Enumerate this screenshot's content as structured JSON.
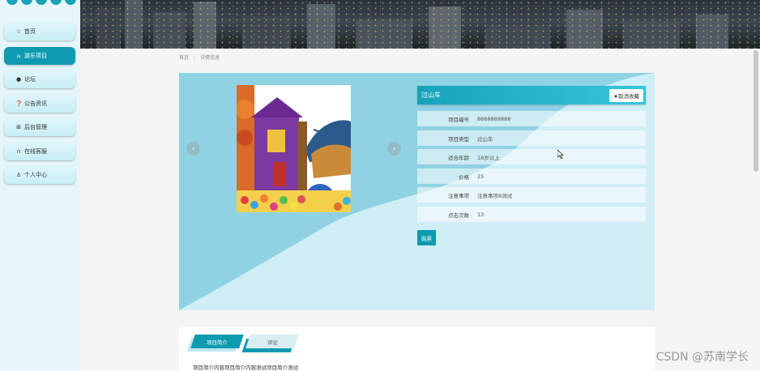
{
  "sidebar": {
    "items": [
      {
        "label": "首页",
        "icon": "star-icon",
        "active": false
      },
      {
        "label": "游乐项目",
        "icon": "bag-icon",
        "active": true
      },
      {
        "label": "论坛",
        "icon": "dot-icon",
        "active": false
      },
      {
        "label": "公告资讯",
        "icon": "help-icon",
        "active": false
      },
      {
        "label": "后台管理",
        "icon": "gift-icon",
        "active": false
      },
      {
        "label": "在线客服",
        "icon": "headset-icon",
        "active": false
      },
      {
        "label": "个人中心",
        "icon": "user-icon",
        "active": false
      }
    ]
  },
  "breadcrumb": {
    "home": "首页",
    "current": "详情信息"
  },
  "detail": {
    "title": "过山车",
    "favorite_label": "★取消收藏",
    "fields": [
      {
        "label": "项目编号",
        "value": "8888888888"
      },
      {
        "label": "项目类型",
        "value": "过山车"
      },
      {
        "label": "适合年龄",
        "value": "18岁以上"
      },
      {
        "label": "价格",
        "value": "25"
      },
      {
        "label": "注意事项",
        "value": "注意事项8测试"
      },
      {
        "label": "点击次数",
        "value": "13"
      }
    ],
    "buy_label": "购票",
    "prev_arrow": "‹",
    "next_arrow": "›"
  },
  "tabs": [
    {
      "label": "项目简介",
      "active": true
    },
    {
      "label": "评论",
      "active": false
    }
  ],
  "tab_content": "项目简介内容项目简介内容测试项目简介测试",
  "watermark": "CSDN @苏南学长",
  "colors": {
    "accent": "#0e9bb0",
    "panel": "#bfe8f2",
    "sidebar": "#e6f6fa"
  }
}
